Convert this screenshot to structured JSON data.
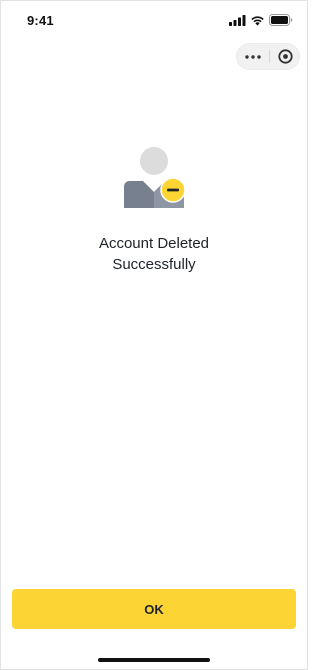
{
  "status_bar": {
    "time": "9:41",
    "icons": [
      "signal-icon",
      "wifi-icon",
      "battery-icon"
    ]
  },
  "capsule": {
    "icons": [
      "more-icon",
      "close-icon"
    ]
  },
  "content": {
    "illustration": "user-removed-icon",
    "message_line1": "Account Deleted",
    "message_line2": "Successfully"
  },
  "footer": {
    "ok_label": "OK"
  },
  "colors": {
    "accent": "#fcd535",
    "text": "#1e2329",
    "avatar_gray": "#dcdcdc",
    "body_gray": "#76808f"
  }
}
